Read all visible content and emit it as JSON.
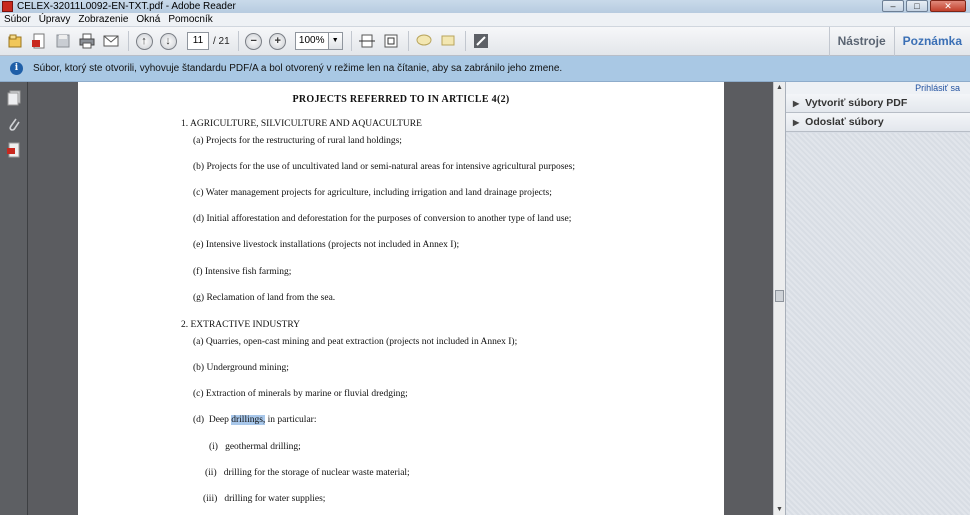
{
  "window": {
    "title": "CELEX-32011L0092-EN-TXT.pdf - Adobe Reader",
    "minimize": "–",
    "maximize": "□",
    "close": "✕"
  },
  "menu": [
    "Súbor",
    "Úpravy",
    "Zobrazenie",
    "Okná",
    "Pomocník"
  ],
  "toolbar": {
    "page_current": "11",
    "page_total": "/ 21",
    "zoom": "100%",
    "tools_label": "Nástroje",
    "comment_label": "Poznámka"
  },
  "infobar": {
    "message": "Súbor, ktorý ste otvorili, vyhovuje štandardu PDF/A a bol otvorený v režime len na čítanie, aby sa zabránilo jeho zmene."
  },
  "right_panel": {
    "sign_in": "Prihlásiť sa",
    "sections": [
      "Vytvoriť súbory PDF",
      "Odoslať súbory"
    ]
  },
  "document": {
    "title": "PROJECTS REFERRED TO IN ARTICLE 4(2)",
    "section1_heading": "1.  AGRICULTURE, SILVICULTURE AND AQUACULTURE",
    "section1_items": [
      "(a)  Projects for the restructuring of rural land holdings;",
      "(b)  Projects for the use of uncultivated land or semi-natural areas for intensive agricultural purposes;",
      "(c)  Water management projects for agriculture, including irrigation and land drainage projects;",
      "(d)  Initial afforestation and deforestation for the purposes of conversion to another type of land use;",
      "(e)  Intensive livestock installations (projects not included in Annex I);",
      "(f)  Intensive fish farming;",
      "(g)  Reclamation of land from the sea."
    ],
    "section2_heading": "2.  EXTRACTIVE INDUSTRY",
    "section2_items": [
      "(a)  Quarries, open-cast mining and peat extraction (projects not included in Annex I);",
      "(b)  Underground mining;",
      "(c)  Extraction of minerals by marine or fluvial dredging;"
    ],
    "deep_prefix": "(d)  Deep ",
    "deep_highlight": "drillings,",
    "deep_suffix": " in particular:",
    "sub_items": [
      "(i)   geothermal drilling;",
      "(ii)   drilling for the storage of nuclear waste material;",
      "(iii)   drilling for water supplies;"
    ]
  }
}
